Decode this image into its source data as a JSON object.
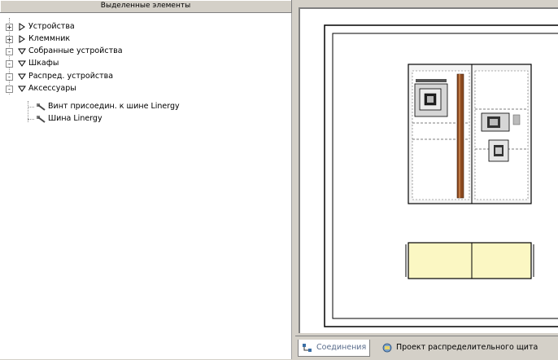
{
  "tree_panel": {
    "header": "Выделенные элементы",
    "items": [
      {
        "label": "Устройства",
        "expander": "+",
        "state": "collapsed"
      },
      {
        "label": "Клеммник",
        "expander": "+",
        "state": "collapsed"
      },
      {
        "label": "Собранные устройства",
        "expander": "-",
        "state": "expanded"
      },
      {
        "label": "Шкафы",
        "expander": "-",
        "state": "expanded"
      },
      {
        "label": "Распред. устройства",
        "expander": "-",
        "state": "expanded"
      },
      {
        "label": "Аксессуары",
        "expander": "-",
        "state": "expanded"
      }
    ],
    "children": [
      {
        "label": "Винт присоедин. к шине Linergy",
        "icon": "wrench-icon"
      },
      {
        "label": "Шина Linergy",
        "icon": "wrench-icon"
      }
    ]
  },
  "tabs": [
    {
      "label": "Соединения",
      "active": true,
      "icon": "connections-icon"
    },
    {
      "label": "Проект распределительного щита",
      "active": false,
      "icon": "project-icon"
    }
  ],
  "colors": {
    "window_bg": "#d4d0c8",
    "cabinet_top_fill": "#fbf7c3",
    "busbar_brown": "#8b4a20",
    "active_tab_text": "#5a6d8c"
  }
}
